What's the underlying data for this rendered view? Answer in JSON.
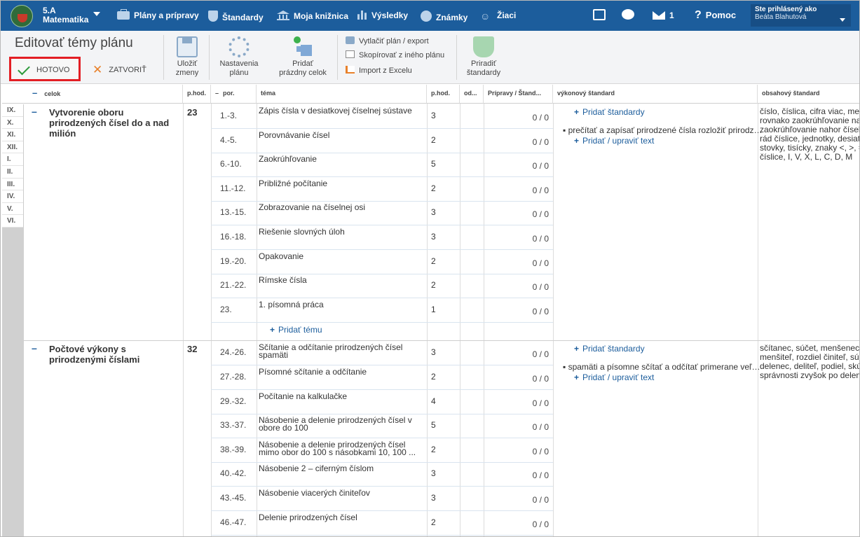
{
  "header": {
    "class_name": "5.A",
    "subject": "Matematika",
    "nav": [
      {
        "label": "Plány a prípravy",
        "icon": "briefcase-icon"
      },
      {
        "label": "Štandardy",
        "icon": "shield-icon"
      },
      {
        "label": "Moja knižnica",
        "icon": "library-icon"
      },
      {
        "label": "Výsledky",
        "icon": "bar-chart-icon"
      },
      {
        "label": "Známky",
        "icon": "grade-icon"
      },
      {
        "label": "Žiaci",
        "icon": "students-icon"
      }
    ],
    "messages_count": "1",
    "help_label": "Pomoc",
    "user_label": "Ste prihlásený ako",
    "user_name": "Beáta Blahutová"
  },
  "toolbar": {
    "title": "Editovať témy plánu",
    "done_label": "HOTOVO",
    "close_label": "ZATVORIŤ",
    "save_label_1": "Uložiť",
    "save_label_2": "zmeny",
    "settings_label_1": "Nastavenia",
    "settings_label_2": "plánu",
    "add_group_label_1": "Pridať",
    "add_group_label_2": "prázdny celok",
    "print_label": "Vytlačiť plán / export",
    "copy_label": "Skopírovať z iného plánu",
    "import_label": "Import z Excelu",
    "assign_label_1": "Priradiť",
    "assign_label_2": "štandardy"
  },
  "table": {
    "headers": {
      "celok": "celok",
      "phod": "p.hod.",
      "por": "por.",
      "tema": "téma",
      "phod2": "p.hod.",
      "od": "od...",
      "pripravy": "Prípravy / Štand...",
      "vykonovy": "výkonový štandard",
      "obsahovy": "obsahový štandard"
    },
    "grades": [
      "IX.",
      "X.",
      "XI.",
      "XII.",
      "I.",
      "II.",
      "III.",
      "IV.",
      "V.",
      "VI."
    ],
    "groups": [
      {
        "name": "Vytvorenie oboru prirodzených čísel do a nad milión",
        "hours": "23",
        "rows": [
          {
            "por": "1.-3.",
            "tema": "Zápis čísla v desiatkovej číselnej sústave",
            "hod": "3",
            "prep": "0 / 0"
          },
          {
            "por": "4.-5.",
            "tema": "Porovnávanie čísel",
            "hod": "2",
            "prep": "0 / 0"
          },
          {
            "por": "6.-10.",
            "tema": "Zaokrúhľovanie",
            "hod": "5",
            "prep": "0 / 0"
          },
          {
            "por": "11.-12.",
            "tema": "Približné počítanie",
            "hod": "2",
            "prep": "0 / 0"
          },
          {
            "por": "13.-15.",
            "tema": "Zobrazovanie na číselnej osi",
            "hod": "3",
            "prep": "0 / 0"
          },
          {
            "por": "16.-18.",
            "tema": "Riešenie slovných úloh",
            "hod": "3",
            "prep": "0 / 0"
          },
          {
            "por": "19.-20.",
            "tema": "Opakovanie",
            "hod": "2",
            "prep": "0 / 0"
          },
          {
            "por": "21.-22.",
            "tema": "Rímske čísla",
            "hod": "2",
            "prep": "0 / 0"
          },
          {
            "por": "23.",
            "tema": "1. písomná práca",
            "hod": "1",
            "prep": "0 / 0"
          }
        ],
        "add_topic": "Pridať tému",
        "add_standards": "Pridať štandardy",
        "performance": "prečítať a zapísať prirodzené čísla rozložiť prirodzené čísla",
        "add_text": "Pridať / upraviť text",
        "content": "číslo, číslica, cifra viac, menej\nrovnako zaokrúhľovanie nadol\nzaokrúhľovanie nahor číselná os\nrád číslice, jednotky, desiatky\nstovky, tisícky, znaky <, >, =\nčíslice, I, V, X, L, C, D, M"
      },
      {
        "name": "Počtové výkony s prirodzenými číslami",
        "hours": "32",
        "rows": [
          {
            "por": "24.-26.",
            "tema": "Sčítanie a odčítanie prirodzených čísel spamäti",
            "hod": "3",
            "prep": "0 / 0"
          },
          {
            "por": "27.-28.",
            "tema": "Písomné sčítanie a odčítanie",
            "hod": "2",
            "prep": "0 / 0"
          },
          {
            "por": "29.-32.",
            "tema": "Počítanie na kalkulačke",
            "hod": "4",
            "prep": "0 / 0"
          },
          {
            "por": "33.-37.",
            "tema": "Násobenie a delenie prirodzených čísel v obore do 100",
            "hod": "5",
            "prep": "0 / 0"
          },
          {
            "por": "38.-39.",
            "tema": "Násobenie a delenie prirodzených čísel mimo obor do 100 s násobkami 10, 100 ...",
            "hod": "2",
            "prep": "0 / 0"
          },
          {
            "por": "40.-42.",
            "tema": "Násobenie 2 – ciferným číslom",
            "hod": "3",
            "prep": "0 / 0"
          },
          {
            "por": "43.-45.",
            "tema": "Násobenie viacerých činiteľov",
            "hod": "3",
            "prep": "0 / 0"
          },
          {
            "por": "46.-47.",
            "tema": "Delenie prirodzených čísel",
            "hod": "2",
            "prep": "0 / 0"
          }
        ],
        "add_standards": "Pridať štandardy",
        "performance": "spamäti a písomne sčítať a odčítať primerane veľké čísla",
        "add_text": "Pridať / upraviť text",
        "content": "sčítanec, súčet, menšenec,\nmenšiteľ, rozdiel činiteľ, súčin\ndelenec, deliteľ, podiel, skúška\nsprávnosti zvyšok po delení"
      }
    ]
  }
}
